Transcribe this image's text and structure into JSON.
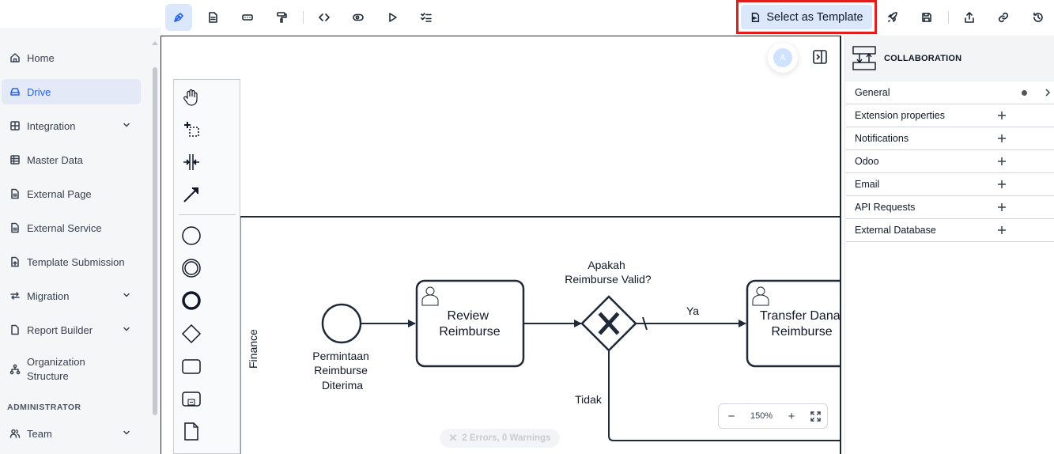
{
  "toolbar": {
    "tools": [
      {
        "name": "modeler-tool",
        "icon": "pen-icon",
        "active": true
      },
      {
        "name": "document-tool",
        "icon": "document-icon"
      },
      {
        "name": "form-tool",
        "icon": "input-field-icon"
      },
      {
        "name": "style-tool",
        "icon": "paint-roller-icon"
      },
      {
        "name": "code-tool",
        "icon": "code-icon"
      },
      {
        "name": "preview-tool",
        "icon": "eye-icon"
      },
      {
        "name": "run-tool",
        "icon": "play-icon"
      },
      {
        "name": "checklist-tool",
        "icon": "checklist-icon"
      }
    ],
    "template_button_label": "Select as Template",
    "right_actions": [
      "rocket-icon",
      "save-icon",
      "share-icon",
      "link-icon",
      "history-icon"
    ]
  },
  "sidebar": {
    "items": [
      {
        "label": "Home",
        "icon": "home-icon"
      },
      {
        "label": "Drive",
        "icon": "drive-icon",
        "active": true
      },
      {
        "label": "Integration",
        "icon": "grid-icon",
        "expandable": true
      },
      {
        "label": "Master Data",
        "icon": "table-icon"
      },
      {
        "label": "External Page",
        "icon": "file-icon"
      },
      {
        "label": "External Service",
        "icon": "file-icon"
      },
      {
        "label": "Template Submission",
        "icon": "file-export-icon"
      },
      {
        "label": "Migration",
        "icon": "swap-icon",
        "expandable": true
      },
      {
        "label": "Report Builder",
        "icon": "file-icon",
        "expandable": true
      },
      {
        "label": "Organization Structure",
        "icon": "org-icon"
      },
      {
        "label": "Team",
        "icon": "users-icon",
        "expandable": true
      }
    ],
    "section_admin": "ADMINISTRATOR"
  },
  "diagram": {
    "lane_label": "Finance",
    "start_event_label": "Permintaan Reimburse Diterima",
    "task1_label": "Review Reimburse",
    "gateway_label": "Apakah Reimburse Valid?",
    "flow_yes": "Ya",
    "flow_no": "Tidak",
    "task2_label": "Transfer Dana Reimburse"
  },
  "collab_avatar_initial": "A",
  "zoom": {
    "level": "150%",
    "minus": "−",
    "plus": "+"
  },
  "validation": {
    "text": "2 Errors, 0 Warnings"
  },
  "properties": {
    "title": "COLLABORATION",
    "groups": [
      {
        "label": "General",
        "expandable": true,
        "has_dot": true
      },
      {
        "label": "Extension properties"
      },
      {
        "label": "Notifications"
      },
      {
        "label": "Odoo"
      },
      {
        "label": "Email"
      },
      {
        "label": "API Requests"
      },
      {
        "label": "External Database"
      }
    ]
  }
}
